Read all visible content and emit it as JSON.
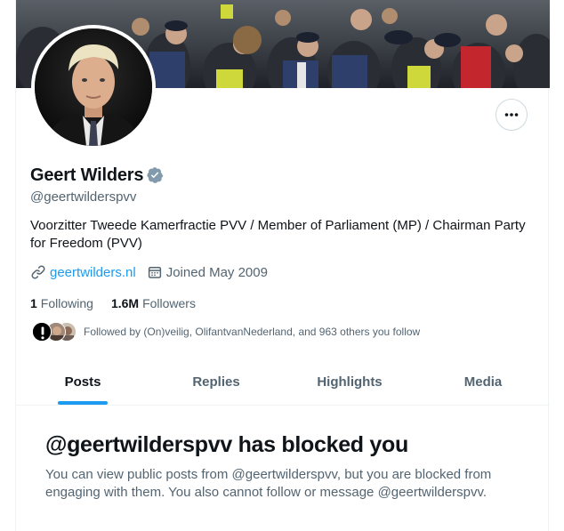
{
  "profile": {
    "name": "Geert Wilders",
    "handle": "@geertwilderspvv",
    "bio": "Voorzitter Tweede Kamerfractie PVV / Member of Parliament (MP) / Chairman Party for Freedom (PVV)",
    "website": "geertwilders.nl",
    "joined": "Joined May 2009",
    "verified": true
  },
  "stats": {
    "following_count": "1",
    "following_label": "Following",
    "followers_count": "1.6M",
    "followers_label": "Followers"
  },
  "followed_by": {
    "text": "Followed by (On)veilig, OlifantvanNederland, and 963 others you follow"
  },
  "tabs": [
    {
      "label": "Posts",
      "active": true
    },
    {
      "label": "Replies",
      "active": false
    },
    {
      "label": "Highlights",
      "active": false
    },
    {
      "label": "Media",
      "active": false
    }
  ],
  "blocked": {
    "title": "@geertwilderspvv has blocked you",
    "body": "You can view public posts from @geertwilderspvv, but you are blocked from engaging with them. You also cannot follow or message @geertwilderspvv."
  },
  "icons": {
    "more": "more-horizontal-icon",
    "verified": "verified-badge-icon",
    "link": "link-icon",
    "calendar": "calendar-icon"
  },
  "colors": {
    "accent": "#1d9bf0",
    "text_primary": "#0f1419",
    "text_secondary": "#536471",
    "verified_badge": "#829aab",
    "border": "#eff3f4"
  }
}
